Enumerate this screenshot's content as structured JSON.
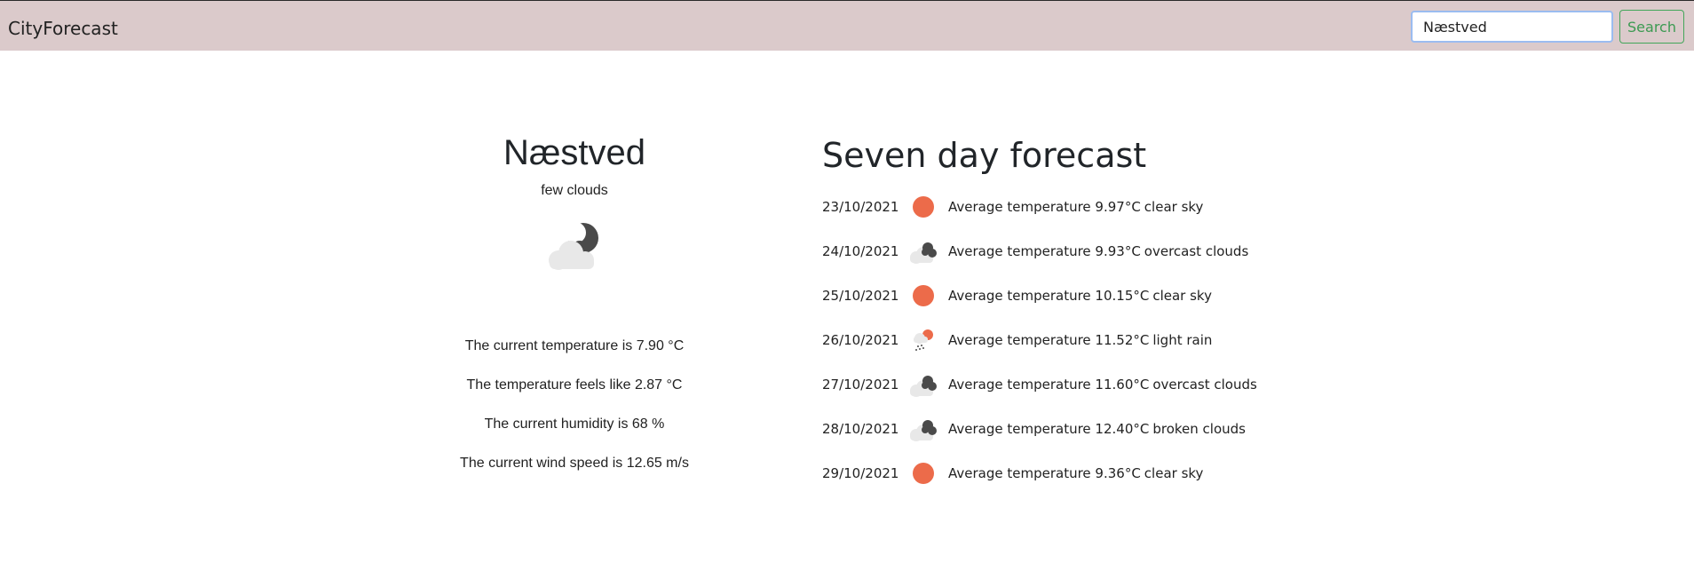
{
  "navbar": {
    "brand": "CityForecast",
    "search_value": "Næstved",
    "search_button": "Search"
  },
  "current": {
    "city": "Næstved",
    "description": "few clouds",
    "icon": "few-clouds-night-icon",
    "stats": [
      "The current temperature is 7.90 °C",
      "The temperature feels like 2.87 °C",
      "The current humidity is 68 %",
      "The current wind speed is 12.65 m/s"
    ]
  },
  "forecast": {
    "title": "Seven day forecast",
    "days": [
      {
        "date": "23/10/2021",
        "text": "Average temperature 9.97°C",
        "desc": "clear sky",
        "icon": "sun-icon"
      },
      {
        "date": "24/10/2021",
        "text": "Average temperature 9.93°C",
        "desc": "overcast clouds",
        "icon": "overcast-clouds-icon"
      },
      {
        "date": "25/10/2021",
        "text": "Average temperature 10.15°C",
        "desc": "clear sky",
        "icon": "sun-icon"
      },
      {
        "date": "26/10/2021",
        "text": "Average temperature 11.52°C",
        "desc": "light rain",
        "icon": "light-rain-icon"
      },
      {
        "date": "27/10/2021",
        "text": "Average temperature 11.60°C",
        "desc": "overcast clouds",
        "icon": "overcast-clouds-icon"
      },
      {
        "date": "28/10/2021",
        "text": "Average temperature 12.40°C",
        "desc": "broken clouds",
        "icon": "broken-clouds-icon"
      },
      {
        "date": "29/10/2021",
        "text": "Average temperature 9.36°C",
        "desc": "clear sky",
        "icon": "sun-icon"
      }
    ]
  },
  "colors": {
    "navbar": "#dbcacb",
    "search_button": "#43a65a",
    "sun": "#ec6b4a",
    "cloud_dark": "#4a4a4a",
    "cloud_light": "#e8e8e8"
  }
}
